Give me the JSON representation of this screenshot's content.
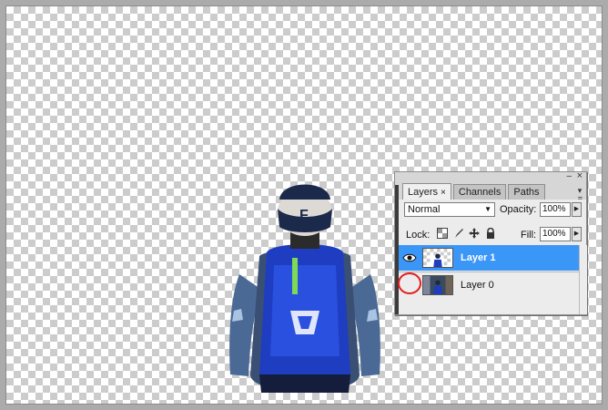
{
  "layers_panel": {
    "tabs": [
      {
        "label": "Layers",
        "close": "×"
      },
      {
        "label": "Channels"
      },
      {
        "label": "Paths"
      }
    ],
    "window_controls": {
      "minimize": "–",
      "close": "×"
    },
    "menu_icon": "panel-menu-icon",
    "blend_mode": "Normal",
    "opacity_label": "Opacity:",
    "opacity_value": "100%",
    "lock_label": "Lock:",
    "lock_icons": [
      "lock-transparent-pixels-icon",
      "lock-image-pixels-icon",
      "lock-position-icon",
      "lock-all-icon"
    ],
    "fill_label": "Fill:",
    "fill_value": "100%",
    "layers": [
      {
        "name": "Layer 1",
        "visible": true,
        "selected": true
      },
      {
        "name": "Layer 0",
        "visible": false,
        "selected": false
      }
    ],
    "accent_color": "#3a96f7",
    "annotation_color": "#e41c1c"
  }
}
